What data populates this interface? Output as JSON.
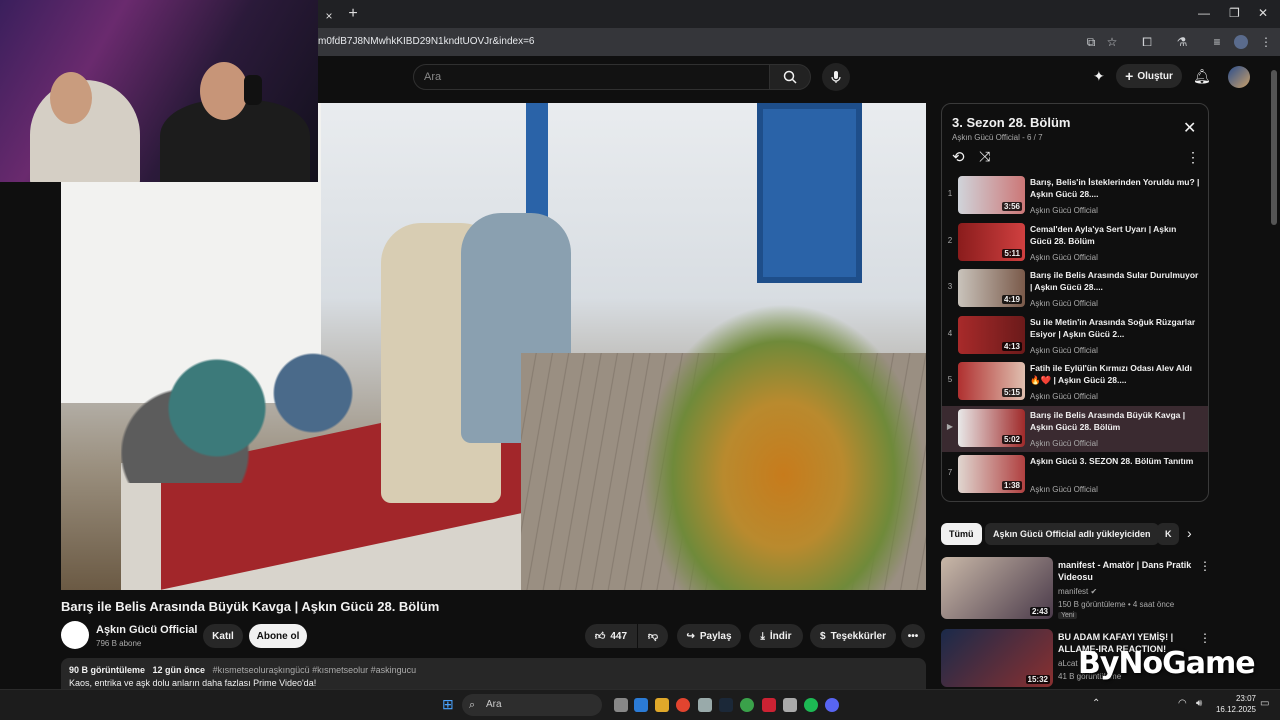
{
  "browser": {
    "url": "m0fdB7J8NMwhkKIBD29N1kndtUOVJr&index=6",
    "new_tab_label": "+",
    "close_tab_label": "×"
  },
  "youtube": {
    "search_placeholder": "Ara",
    "create_label": "Oluştur"
  },
  "video": {
    "title": "Barış ile Belis Arasında Büyük Kavga | Aşkın Gücü 28. Bölüm",
    "channel_name": "Aşkın Gücü Official",
    "subscribers": "796 B abone",
    "join_label": "Katıl",
    "subscribe_label": "Abone ol",
    "likes": "447",
    "share_label": "Paylaş",
    "download_label": "İndir",
    "thanks_label": "Teşekkürler",
    "views": "90 B görüntüleme",
    "age": "12 gün önce",
    "hashtags": "#kısmetseoluraşkıngücü #kısmetseolur #askingucu",
    "description_line": "Kaos, entrika ve aşk dolu anların daha fazlası Prime Video'da!"
  },
  "playlist": {
    "title": "3. Sezon 28. Bölüm",
    "channel": "Aşkın Gücü Official",
    "position": "6 / 7",
    "items": [
      {
        "index": "1",
        "title": "Barış, Belis'in İsteklerinden Yoruldu mu? | Aşkın Gücü 28....",
        "channel": "Aşkın Gücü Official",
        "duration": "3:56"
      },
      {
        "index": "2",
        "title": "Cemal'den Ayla'ya Sert Uyarı | Aşkın Gücü 28. Bölüm",
        "channel": "Aşkın Gücü Official",
        "duration": "5:11"
      },
      {
        "index": "3",
        "title": "Barış ile Belis Arasında Sular Durulmuyor | Aşkın Gücü 28....",
        "channel": "Aşkın Gücü Official",
        "duration": "4:19"
      },
      {
        "index": "4",
        "title": "Su ile Metin'in Arasında Soğuk Rüzgarlar Esiyor | Aşkın Gücü 2...",
        "channel": "Aşkın Gücü Official",
        "duration": "4:13"
      },
      {
        "index": "5",
        "title": "Fatih ile Eylül'ün Kırmızı Odası Alev Aldı 🔥❤️ | Aşkın Gücü 28....",
        "channel": "Aşkın Gücü Official",
        "duration": "5:15"
      },
      {
        "index": "▶",
        "title": "Barış ile Belis Arasında Büyük Kavga | Aşkın Gücü 28. Bölüm",
        "channel": "Aşkın Gücü Official",
        "duration": "5:02"
      },
      {
        "index": "7",
        "title": "Aşkın Gücü 3. SEZON 28. Bölüm Tanıtım",
        "channel": "Aşkın Gücü Official",
        "duration": "1:38"
      }
    ]
  },
  "chips": {
    "all": "Tümü",
    "uploader": "Aşkın Gücü Official adlı yükleyiciden",
    "more": "K"
  },
  "recommendations": [
    {
      "title": "manifest - Amatör | Dans Pratik Videosu",
      "channel": "manifest",
      "meta": "150 B görüntüleme • 4 saat önce",
      "badge": "Yeni",
      "duration": "2:43"
    },
    {
      "title": "BU ADAM KAFAYI YEMİŞ! | ALLAME-IRA REACTION!",
      "channel": "aLcat",
      "meta": "41 B görüntüleme",
      "badge": "",
      "duration": "15:32"
    }
  ],
  "taskbar": {
    "search_label": "Ara",
    "time": "23:07",
    "date": "16.12.2025"
  },
  "watermark": "ByNoGame",
  "colors": {
    "background": "#0f0f0f",
    "active_item": "#3a2a30",
    "pill": "#272727"
  }
}
